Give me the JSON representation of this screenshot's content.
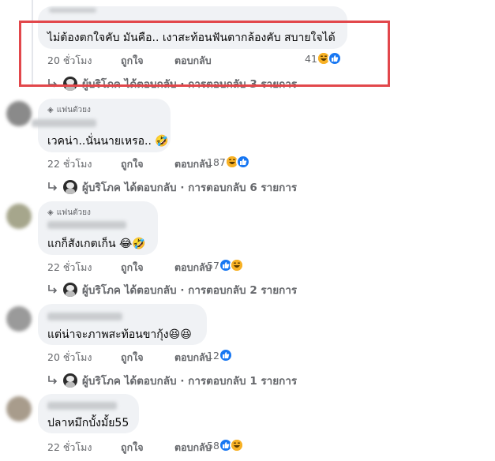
{
  "comments": [
    {
      "text": "ไม่ต้องตกใจคับ มันคือ.. เงาสะท้อนฟันตากล้องคับ สบายใจได้",
      "time": "20 ชั่วโมง",
      "like": "ถูกใจ",
      "reply": "ตอบกลับ",
      "reaction_count": "41",
      "reactions": [
        "haha-icon",
        "like-icon"
      ],
      "replies_text": "ผู้บริโภค ได้ตอบกลับ · การตอบกลับ 3 รายการ",
      "highlighted": true,
      "has_fan_badge": false
    },
    {
      "fan_badge": "แฟนตัวยง",
      "text": "เวคน่า..นั่นนายเหรอ.. 🤣",
      "time": "22 ชั่วโมง",
      "like": "ถูกใจ",
      "reply": "ตอบกลับ",
      "reaction_count": "187",
      "reactions": [
        "haha-icon",
        "like-icon"
      ],
      "replies_text": "ผู้บริโภค ได้ตอบกลับ · การตอบกลับ 6 รายการ",
      "has_fan_badge": true
    },
    {
      "fan_badge": "แฟนตัวยง",
      "text": "แกก็สังเกตเก็น 😂🤣",
      "time": "22 ชั่วโมง",
      "like": "ถูกใจ",
      "reply": "ตอบกลับ",
      "reaction_count": "57",
      "reactions": [
        "like-icon",
        "haha-icon"
      ],
      "replies_text": "ผู้บริโภค ได้ตอบกลับ · การตอบกลับ 2 รายการ",
      "has_fan_badge": true
    },
    {
      "text": "แต่น่าจะภาพสะท้อนขากุ้ง😆😆",
      "time": "20 ชั่วโมง",
      "like": "ถูกใจ",
      "reply": "ตอบกลับ",
      "reaction_count": "12",
      "reactions": [
        "like-icon"
      ],
      "replies_text": "ผู้บริโภค ได้ตอบกลับ · การตอบกลับ 1 รายการ",
      "has_fan_badge": false
    },
    {
      "text": "ปลาหมึกบั้งมั้ย55",
      "time": "22 ชั่วโมง",
      "like": "ถูกใจ",
      "reply": "ตอบกลับ",
      "reaction_count": "58",
      "reactions": [
        "like-icon",
        "haha-icon"
      ],
      "has_fan_badge": false
    }
  ],
  "colors": {
    "bubble": "#f0f2f5",
    "meta_text": "#65676b",
    "like_blue": "#1877f2",
    "haha_yellow": "#f7b125",
    "highlight_red": "#e2474b"
  }
}
